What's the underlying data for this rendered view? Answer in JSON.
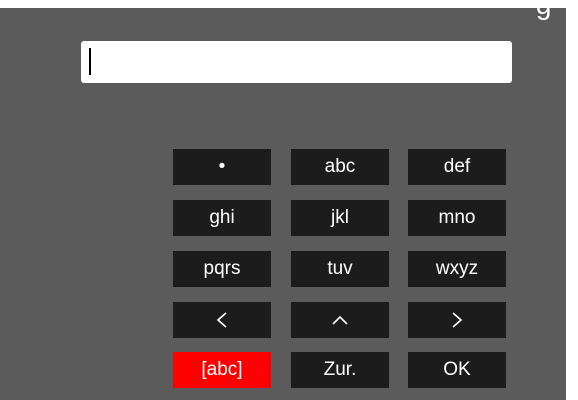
{
  "header": {
    "title_clip": "g"
  },
  "input": {
    "value": ""
  },
  "keypad": {
    "row1": [
      "•",
      "abc",
      "def"
    ],
    "row2": [
      "ghi",
      "jkl",
      "mno"
    ],
    "row3": [
      "pqrs",
      "tuv",
      "wxyz"
    ],
    "row5": [
      "[abc]",
      "Zur.",
      "OK"
    ],
    "nav_icons": [
      "chevron-left-icon",
      "chevron-up-icon",
      "chevron-right-icon"
    ]
  },
  "colors": {
    "panel": "#5b5b5b",
    "key": "#1c1c1c",
    "active_key": "#ff0000",
    "field": "#ffffff"
  }
}
